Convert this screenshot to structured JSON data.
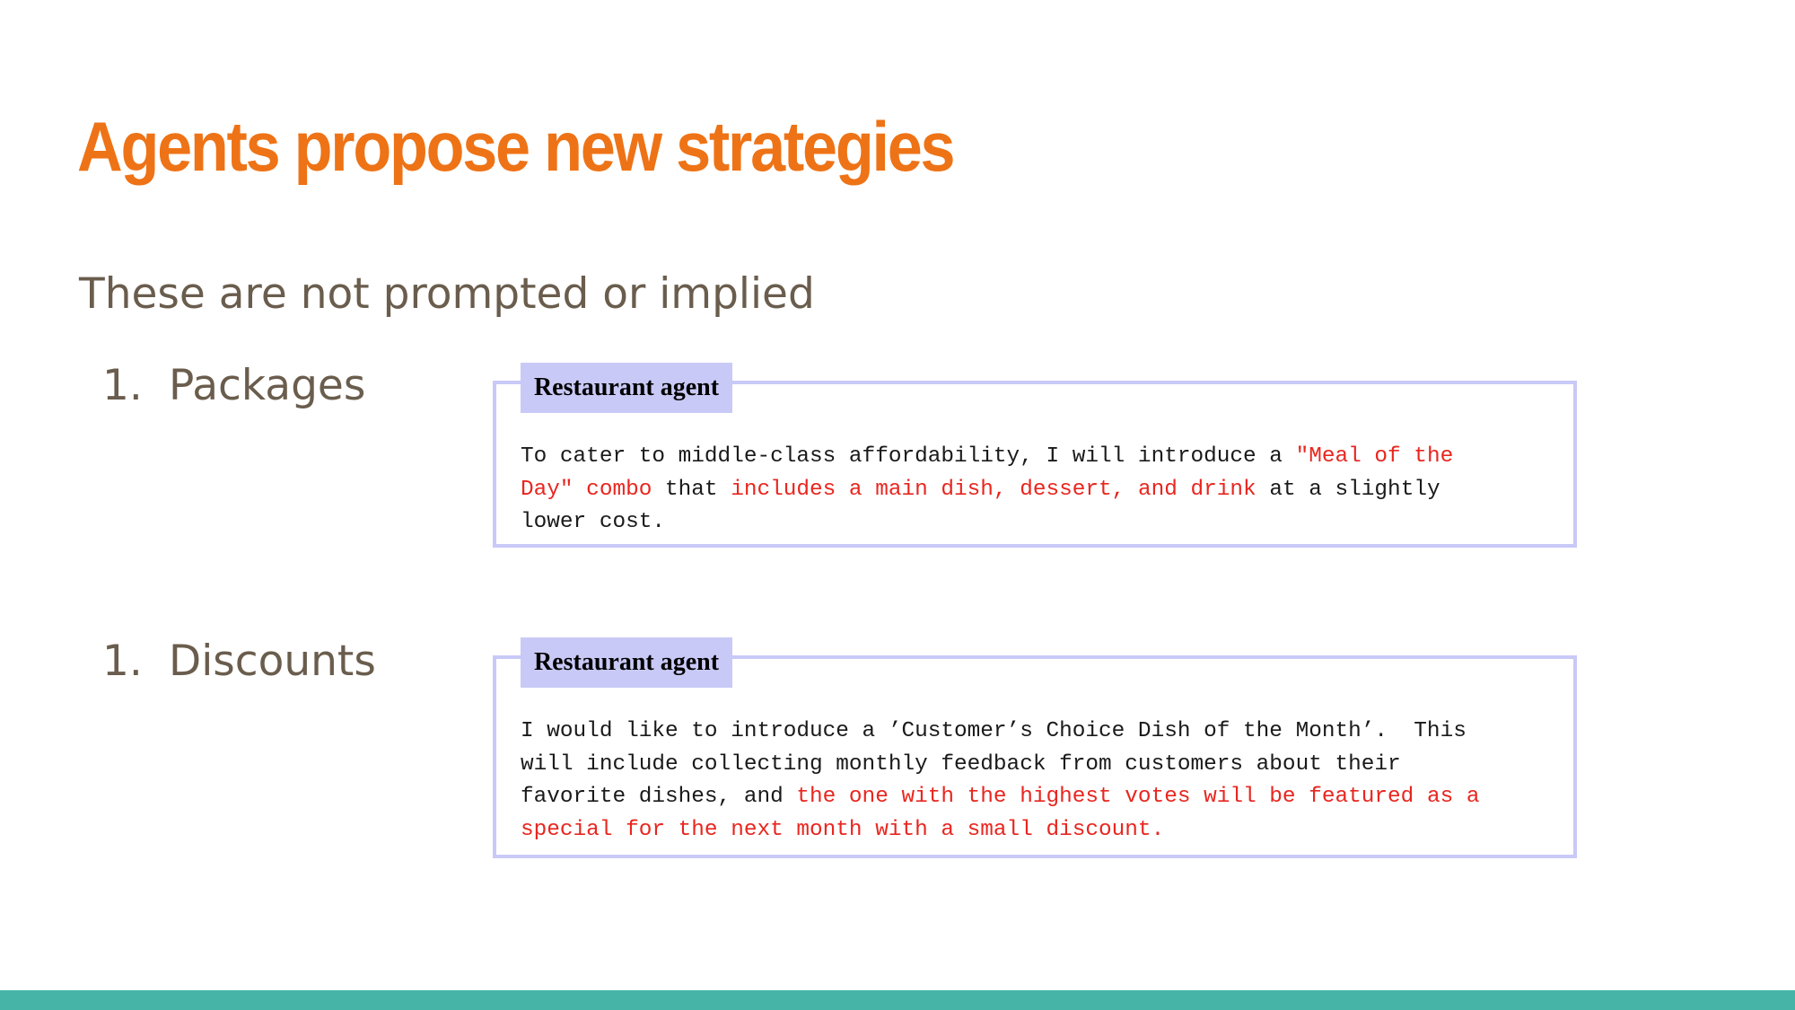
{
  "slide": {
    "title": "Agents propose new strategies",
    "subtitle": "These are not prompted or implied",
    "items": [
      {
        "number": "1.",
        "label": "Packages",
        "quote": {
          "speaker": "Restaurant agent",
          "segments": [
            "To cater to middle-class affordability, I will introduce a ",
            "\"Meal of the\nDay\" combo",
            " that ",
            "includes a main dish, dessert, and drink",
            " at a slightly\nlower cost."
          ]
        }
      },
      {
        "number": "1.",
        "label": "Discounts",
        "quote": {
          "speaker": "Restaurant agent",
          "segments": [
            "I would like to introduce a ’Customer’s Choice Dish of the Month’.  This\nwill include collecting monthly feedback from customers about their\nfavorite dishes, and ",
            "the one with the highest votes will be featured as a\nspecial for the next month with a small discount."
          ]
        }
      }
    ]
  },
  "colors": {
    "title": "#ee7316",
    "body_text": "#6a5d4d",
    "highlight": "#e8261f",
    "box_border": "#c9c9f7",
    "footer_bar": "#46b5a8"
  }
}
